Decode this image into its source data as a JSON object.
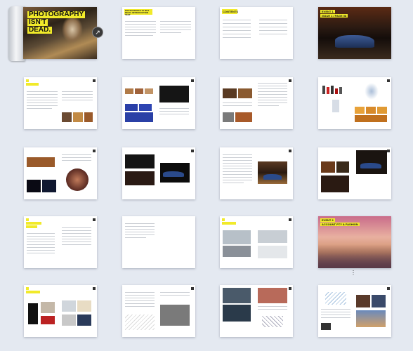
{
  "pages": {
    "p1": {
      "title_lines": [
        "PHOTOGRAPHY",
        "ISN'T",
        "DEAD."
      ]
    },
    "p2": {
      "heading": "PHOTOGRAPHY IS NOT DEAD. INTRODUCTION TEXT"
    },
    "p3": {
      "heading": "CONTENTS"
    },
    "p4": {
      "heading_lines": [
        "EVENT 1",
        "ISSUE 1 / PAGE 08"
      ]
    },
    "p20": {
      "heading_lines": [
        "EVENT 2",
        "ACCOUNT PTY & FASHION"
      ]
    }
  },
  "share_icon_glyph": "↗",
  "scroll_hint": "⋮",
  "colors": {
    "accent_yellow": "#f1ea2a",
    "background": "#e4e9f1"
  }
}
